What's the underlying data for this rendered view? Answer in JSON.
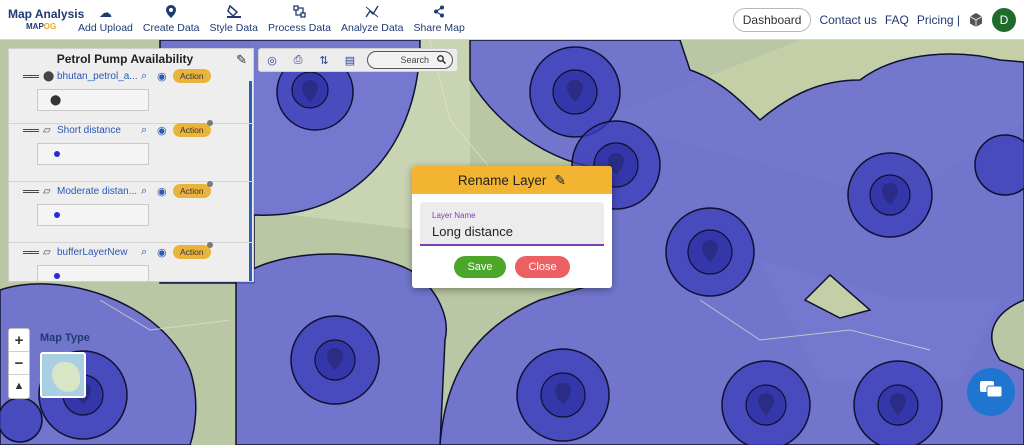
{
  "brand": {
    "title": "Map Analysis",
    "sub_prefix": "MAP",
    "sub_suffix": "OG"
  },
  "nav": [
    {
      "label": "Add Upload",
      "icon": "cloud-upload-icon",
      "glyph": "☁"
    },
    {
      "label": "Create Data",
      "icon": "map-pin-icon",
      "glyph": "⬤"
    },
    {
      "label": "Style Data",
      "icon": "paint-bucket-icon",
      "glyph": "⛁"
    },
    {
      "label": "Process Data",
      "icon": "process-icon",
      "glyph": "⚙"
    },
    {
      "label": "Analyze Data",
      "icon": "analyze-icon",
      "glyph": "⤢"
    },
    {
      "label": "Share Map",
      "icon": "share-icon",
      "glyph": "⇪"
    }
  ],
  "nav_right": {
    "dashboard": "Dashboard",
    "contact": "Contact us",
    "faq": "FAQ",
    "pricing": "Pricing |",
    "avatar": "D"
  },
  "panel": {
    "title": "Petrol Pump Availability",
    "layers": [
      {
        "name": "bhutan_petrol_a...",
        "action": "Action",
        "legend": "pin"
      },
      {
        "name": "Short distance",
        "action": "Action",
        "legend": "dot"
      },
      {
        "name": "Moderate distan...",
        "action": "Action",
        "legend": "dot"
      },
      {
        "name": "bufferLayerNew",
        "action": "Action",
        "legend": "dot"
      }
    ]
  },
  "tools": {
    "search_label": "Search"
  },
  "map_type": {
    "label": "Map Type"
  },
  "zoom": {
    "in": "+",
    "out": "−",
    "reset": "▲"
  },
  "dialog": {
    "title": "Rename Layer",
    "field_label": "Layer Name",
    "field_value": "Long distance",
    "save": "Save",
    "close": "Close"
  },
  "colors": {
    "accent": "#f3b531",
    "brand": "#1f3a73",
    "buffer_fill": "#5a5ad6",
    "save": "#4ca62a",
    "close": "#ec5f62"
  }
}
